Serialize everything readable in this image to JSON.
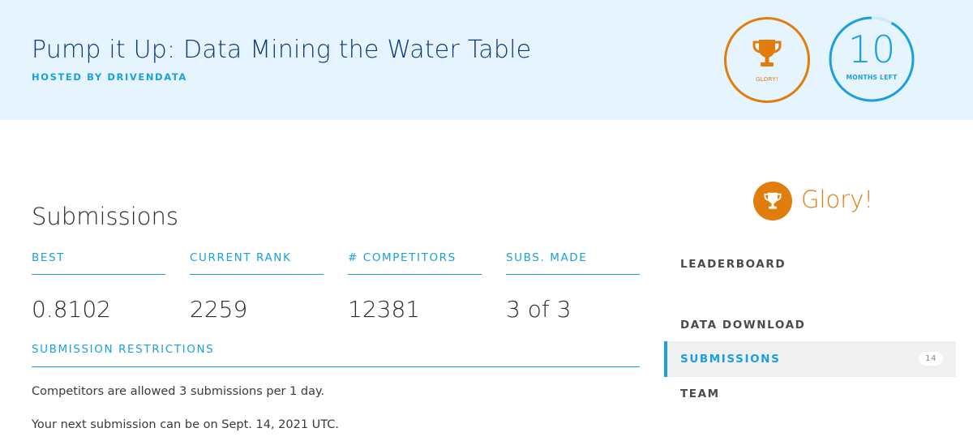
{
  "header": {
    "title": "Pump it Up: Data Mining the Water Table",
    "hosted_by": "HOSTED BY DRIVENDATA",
    "prize": {
      "icon": "trophy-icon",
      "label": "GLORY!"
    },
    "time_left": {
      "value": "10",
      "label": "MONTHS LEFT",
      "elapsed_fraction": 0.08
    }
  },
  "section": {
    "title": "Submissions"
  },
  "stats": [
    {
      "label": "BEST",
      "value": "0.8102"
    },
    {
      "label": "CURRENT RANK",
      "value": "2259"
    },
    {
      "label": "# COMPETITORS",
      "value": "12381"
    },
    {
      "label": "SUBS. MADE",
      "value": "3 of 3"
    }
  ],
  "restrictions": {
    "label": "SUBMISSION RESTRICTIONS",
    "lines": [
      "Competitors are allowed 3 submissions per 1 day.",
      "Your next submission can be on Sept. 14, 2021 UTC."
    ]
  },
  "sidebar": {
    "prize_text": "Glory!",
    "prize_icon": "trophy-icon",
    "nav": [
      {
        "label": "LEADERBOARD",
        "active": false
      },
      {
        "label": "DATA DOWNLOAD",
        "active": false
      },
      {
        "label": "SUBMISSIONS",
        "active": true,
        "badge": "14"
      },
      {
        "label": "TEAM",
        "active": false
      }
    ]
  },
  "colors": {
    "accent": "#1a9fe0",
    "prize": "#e07d0d",
    "title": "#0d3a7a",
    "banner_bg": "#e6f5fd"
  }
}
